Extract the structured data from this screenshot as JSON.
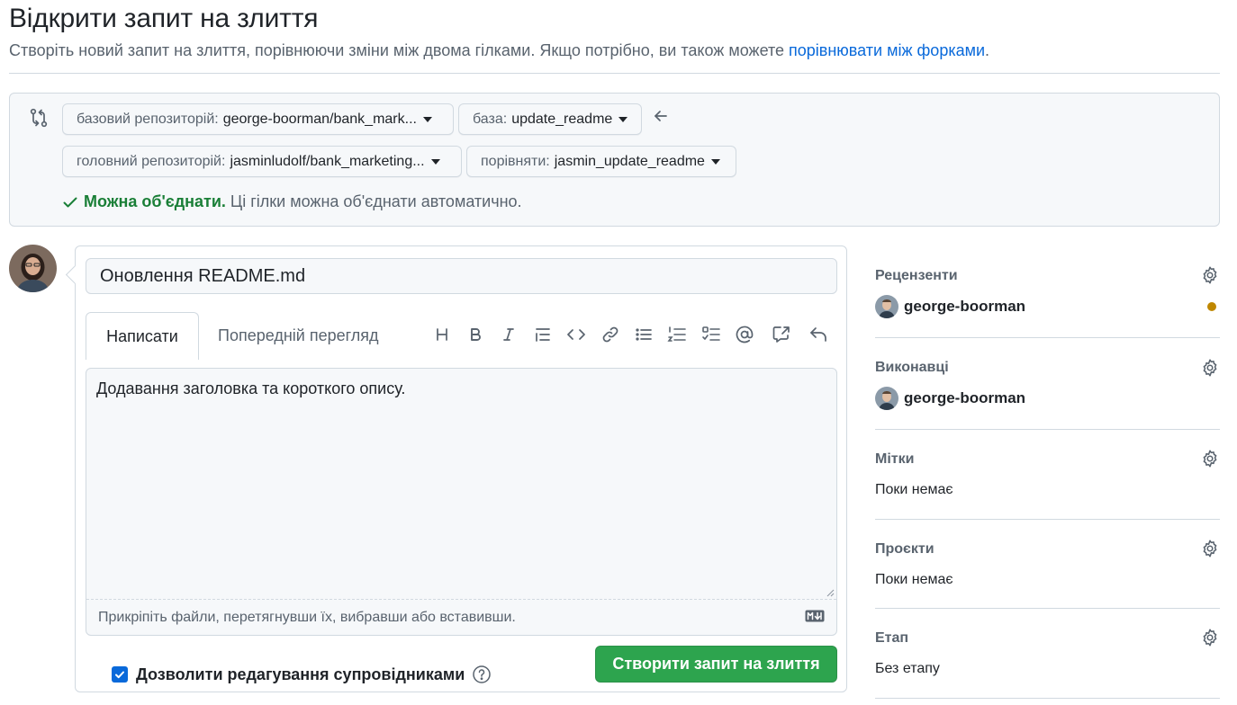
{
  "header": {
    "title": "Відкрити запит на злиття",
    "subtitle_text": "Створіть новий запит на злиття, порівнюючи зміни між двома гілками. Якщо потрібно, ви також можете ",
    "subtitle_link": "порівнювати між форками",
    "subtitle_end": "."
  },
  "range": {
    "base_repo_label": "базовий репозиторій:",
    "base_repo_value": "george-boorman/bank_mark...",
    "base_label": "база:",
    "base_value": "update_readme",
    "head_repo_label": "головний репозиторій:",
    "head_repo_value": "jasminludolf/bank_marketing...",
    "compare_label": "порівняти:",
    "compare_value": "jasmin_update_readme",
    "merge_ok": "Можна об'єднати.",
    "merge_msg": "Ці гілки можна об'єднати автоматично."
  },
  "form": {
    "title_value": "Оновлення README.md",
    "tab_write": "Написати",
    "tab_preview": "Попередній перегляд",
    "body_value": "Додавання заголовка та короткого опису.",
    "attach_hint": "Прикріпіть файли, перетягнувши їх, вибравши або вставивши.",
    "submit_label": "Створити запит на злиття",
    "maintainer_label": "Дозволити редагування супровідниками",
    "maintainer_checked": true,
    "toolbar_icons": [
      "heading-icon",
      "bold-icon",
      "italic-icon",
      "quote-icon",
      "code-icon",
      "link-icon",
      "unordered-list-icon",
      "ordered-list-icon",
      "task-list-icon",
      "mention-icon",
      "cross-reference-icon",
      "undo-icon"
    ]
  },
  "sidebar": {
    "reviewers": {
      "title": "Рецензенти",
      "user": "george-boorman",
      "status_color": "#bf8700"
    },
    "assignees": {
      "title": "Виконавці",
      "user": "george-boorman"
    },
    "labels": {
      "title": "Мітки",
      "value": "Поки немає"
    },
    "projects": {
      "title": "Проєкти",
      "value": "Поки немає"
    },
    "milestone": {
      "title": "Етап",
      "value": "Без етапу"
    }
  },
  "colors": {
    "accent": "#0969da",
    "success": "#1a7f37",
    "submit": "#2da44e"
  }
}
